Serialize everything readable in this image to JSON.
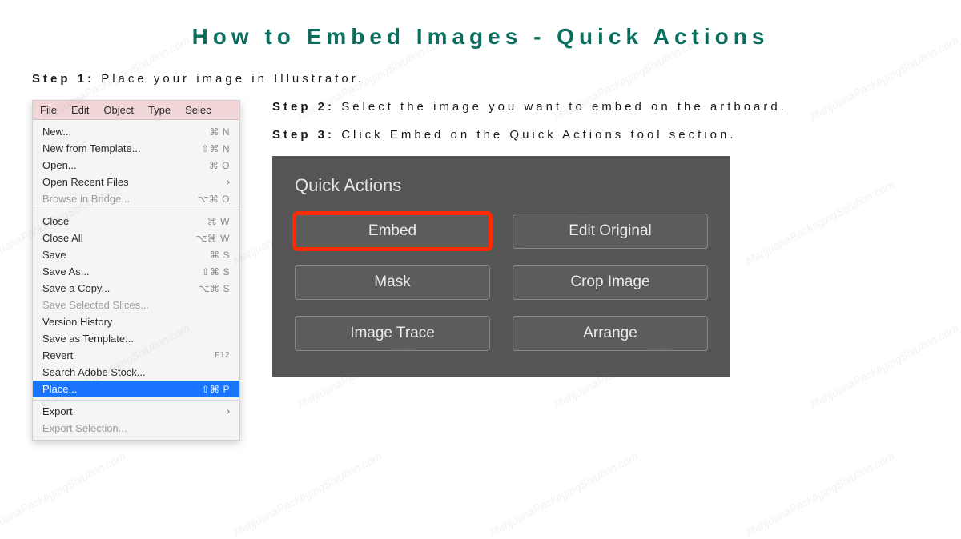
{
  "title": "How to Embed Images - Quick Actions",
  "step1": {
    "label": "Step 1:",
    "text": "Place your image in Illustrator."
  },
  "step2": {
    "label": "Step 2:",
    "text": "Select the image you want to embed on the artboard."
  },
  "step3": {
    "label": "Step 3:",
    "text": "Click Embed on the Quick Actions tool section."
  },
  "menubar": [
    "File",
    "Edit",
    "Object",
    "Type",
    "Selec"
  ],
  "menu": {
    "new": {
      "label": "New...",
      "shortcut": "⌘ N"
    },
    "newTemplate": {
      "label": "New from Template...",
      "shortcut": "⇧⌘ N"
    },
    "open": {
      "label": "Open...",
      "shortcut": "⌘ O"
    },
    "openRecent": {
      "label": "Open Recent Files"
    },
    "browseBridge": {
      "label": "Browse in Bridge...",
      "shortcut": "⌥⌘ O"
    },
    "close": {
      "label": "Close",
      "shortcut": "⌘ W"
    },
    "closeAll": {
      "label": "Close All",
      "shortcut": "⌥⌘ W"
    },
    "save": {
      "label": "Save",
      "shortcut": "⌘ S"
    },
    "saveAs": {
      "label": "Save As...",
      "shortcut": "⇧⌘ S"
    },
    "saveCopy": {
      "label": "Save a Copy...",
      "shortcut": "⌥⌘ S"
    },
    "saveSlices": {
      "label": "Save Selected Slices..."
    },
    "versionHistory": {
      "label": "Version History"
    },
    "saveTemplate": {
      "label": "Save as Template..."
    },
    "revert": {
      "label": "Revert",
      "shortcut": "F12"
    },
    "searchStock": {
      "label": "Search Adobe Stock..."
    },
    "place": {
      "label": "Place...",
      "shortcut": "⇧⌘ P"
    },
    "export": {
      "label": "Export"
    },
    "exportSel": {
      "label": "Export Selection..."
    }
  },
  "qa": {
    "title": "Quick Actions",
    "embed": "Embed",
    "editOriginal": "Edit Original",
    "mask": "Mask",
    "cropImage": "Crop Image",
    "imageTrace": "Image Trace",
    "arrange": "Arrange"
  },
  "watermark": "MarijuanaPackagingSolution.com"
}
